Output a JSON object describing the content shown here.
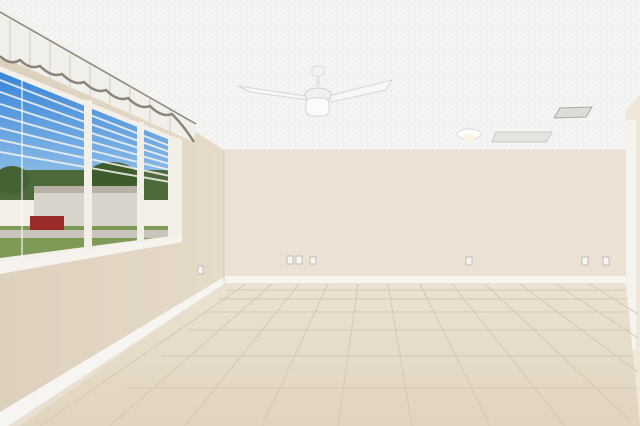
{
  "scene": {
    "description_type": "empty-room-photo",
    "palette": {
      "ceiling": "#f4f4f2",
      "back_wall": "#ebe2d4",
      "left_wall": "#e2d6c4",
      "right_wall": "#efe7da",
      "floor_tile": "#e6dbc9",
      "grout": "#cfc3ae",
      "baseboard": "#f7f5f1",
      "window_sky": "#3e88d8",
      "valance": "#f1efe9",
      "blind_slat": "#f2f2ef"
    },
    "fixtures": [
      "ceiling-fan",
      "ceiling-light",
      "air-vent",
      "return-vent",
      "window",
      "valance",
      "blinds",
      "outlets"
    ]
  }
}
